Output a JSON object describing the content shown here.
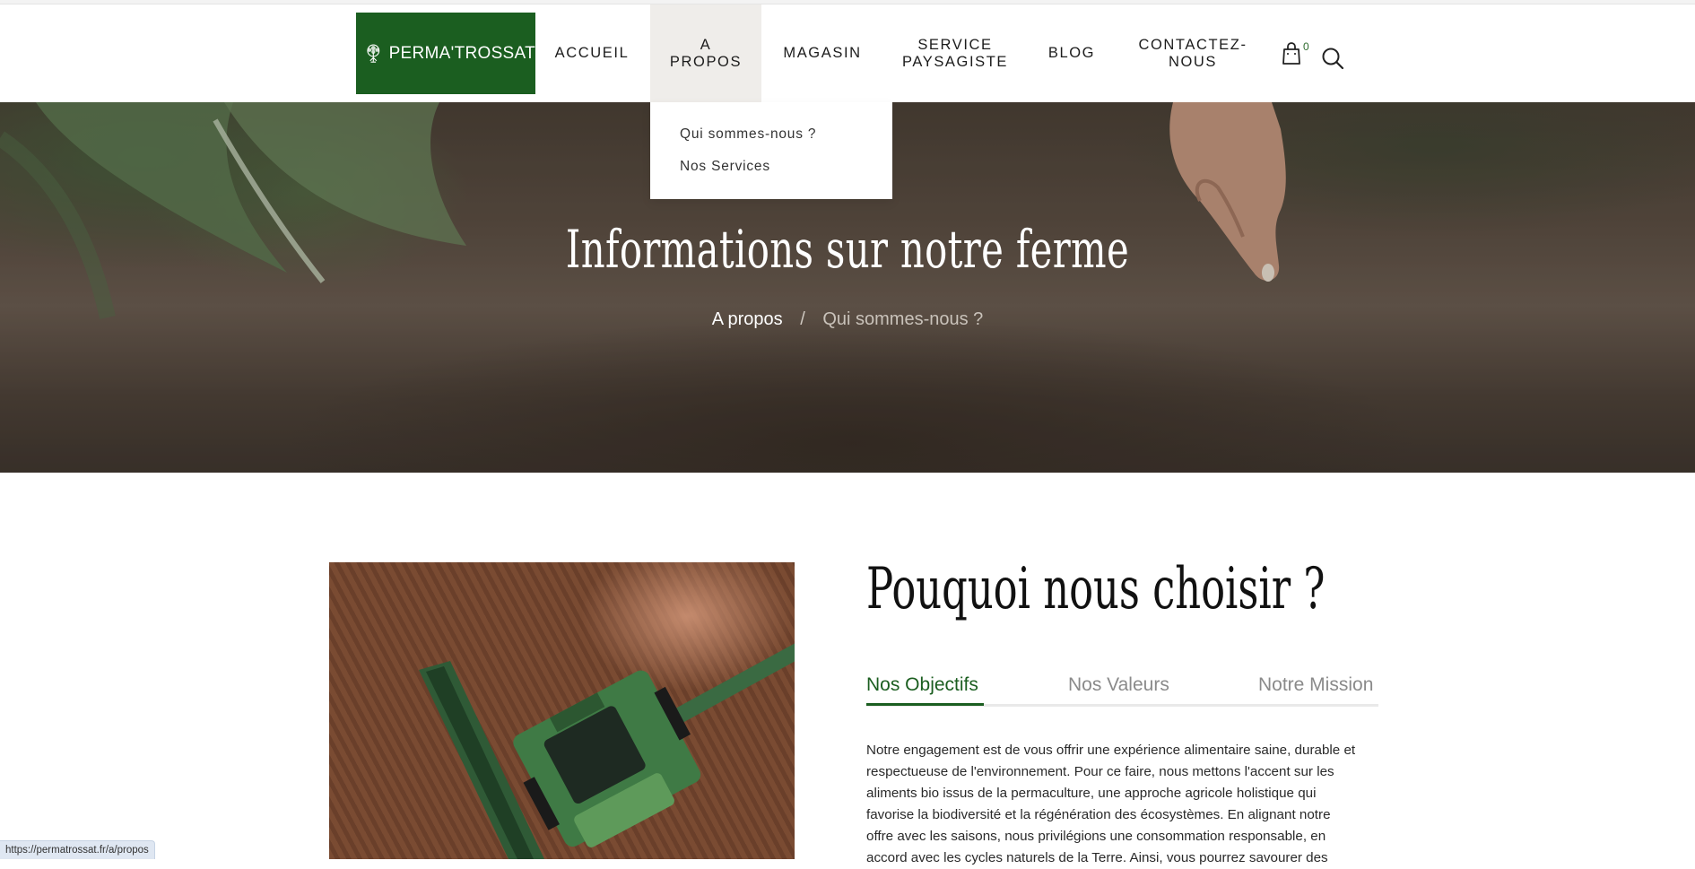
{
  "header": {
    "logo_text": "PERMA'TROSSAT",
    "nav": [
      {
        "label_line1": "ACCUEIL",
        "label_line2": ""
      },
      {
        "label_line1": "A",
        "label_line2": "PROPOS"
      },
      {
        "label_line1": "MAGASIN",
        "label_line2": ""
      },
      {
        "label_line1": "SERVICE",
        "label_line2": "PAYSAGISTE"
      },
      {
        "label_line1": "BLOG",
        "label_line2": ""
      },
      {
        "label_line1": "CONTACTEZ-",
        "label_line2": "NOUS"
      }
    ],
    "cart_count": "0"
  },
  "dropdown": {
    "items": [
      "Qui sommes-nous ?",
      "Nos Services"
    ]
  },
  "hero": {
    "title": "Informations sur notre ferme",
    "breadcrumb": {
      "parent": "A propos",
      "separator": "/",
      "current": "Qui sommes-nous ?"
    }
  },
  "section": {
    "title": "Pouquoi nous choisir ?",
    "tabs": [
      "Nos Objectifs",
      "Nos Valeurs",
      "Notre Mission"
    ],
    "active_tab": "Nos Objectifs",
    "paragraph_lines": [
      "Notre engagement est de vous offrir une expérience alimentaire saine, durable et",
      "respectueuse de l'environnement. Pour ce faire, nous mettons l'accent sur les",
      "aliments bio issus de la permaculture, une approche agricole holistique qui",
      "favorise la biodiversité et la régénération des écosystèmes. En alignant notre",
      "offre avec les saisons, nous privilégions une consommation responsable, en",
      "accord avec les cycles naturels de la Terre. Ainsi, vous pourrez savourer des"
    ]
  },
  "status_bar": {
    "url": "https://permatrossat.fr/a/propos"
  },
  "colors": {
    "brand_green": "#1b5e20",
    "active_nav_bg": "#efedea"
  }
}
